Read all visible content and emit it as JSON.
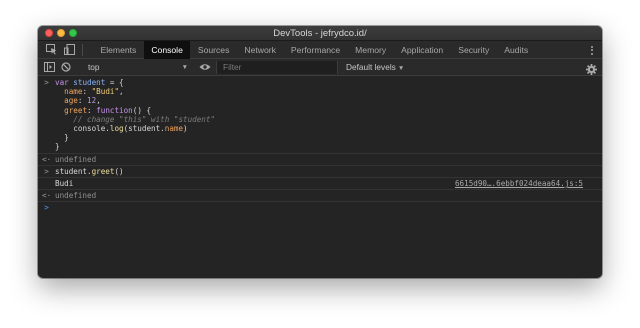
{
  "window": {
    "title": "DevTools - jefrydco.id/"
  },
  "tabs": [
    {
      "label": "Elements",
      "active": false
    },
    {
      "label": "Console",
      "active": true
    },
    {
      "label": "Sources",
      "active": false
    },
    {
      "label": "Network",
      "active": false
    },
    {
      "label": "Performance",
      "active": false
    },
    {
      "label": "Memory",
      "active": false
    },
    {
      "label": "Application",
      "active": false
    },
    {
      "label": "Security",
      "active": false
    },
    {
      "label": "Audits",
      "active": false
    }
  ],
  "toolbar": {
    "context": "top",
    "filter_placeholder": "Filter",
    "levels": "Default levels"
  },
  "console": {
    "code_lines": [
      "var student = {",
      "  name: \"Budi\",",
      "  age: 12,",
      "  greet: function() {",
      "    // change \"this\" with \"student\"",
      "    console.log(student.name)",
      "  }",
      "}"
    ],
    "result_1": "undefined",
    "command_2": "student.greet()",
    "log_output": "Budi",
    "log_source": "6615d90….6ebbf024deaa64.js:5",
    "result_2": "undefined"
  },
  "colors": {
    "background": "#242424",
    "active_tab": "#0f0f0f",
    "prompt_blue": "#4e9cf5"
  },
  "icons": {
    "inspect": "inspect-element-icon",
    "device": "device-toolbar-icon",
    "sidebar": "show-sidebar-icon",
    "clear": "clear-console-icon",
    "eye": "live-expression-eye-icon",
    "gear": "settings-gear-icon",
    "menu": "kebab-menu-icon"
  }
}
